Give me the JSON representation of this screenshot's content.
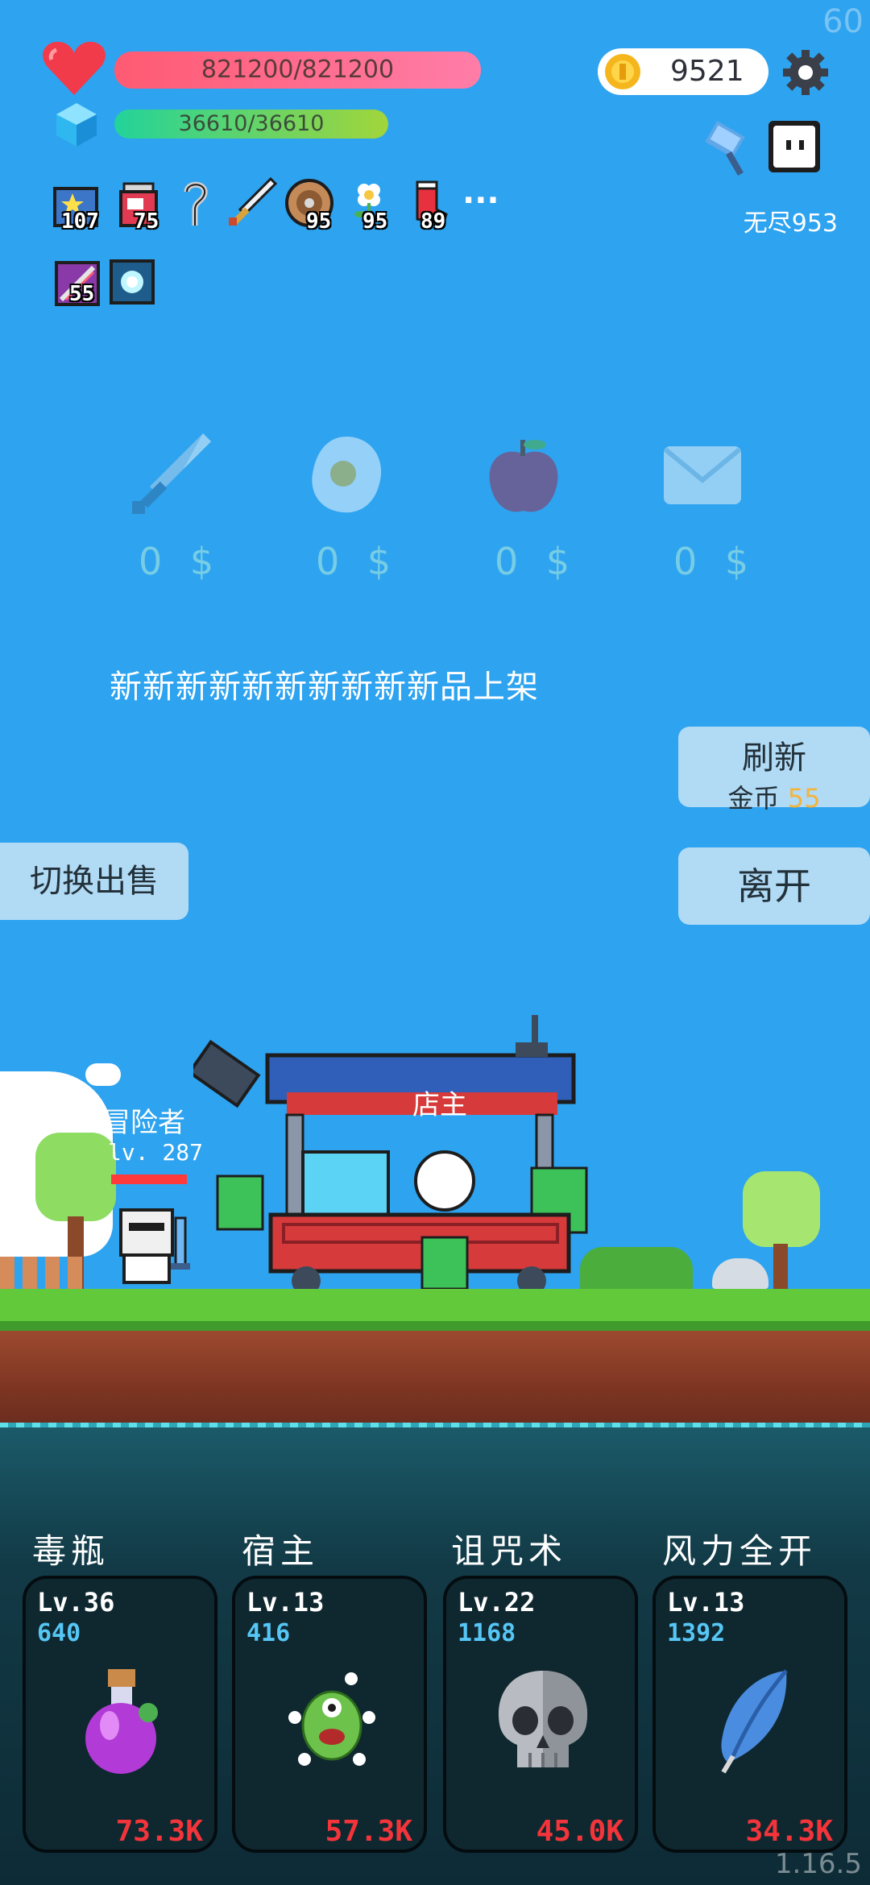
{
  "status": {
    "fps": "60",
    "hp": "821200/821200",
    "mp": "36610/36610",
    "coins": "9521",
    "endless": "无尽953",
    "version": "1.16.5"
  },
  "inventory": {
    "row1": [
      {
        "icon": "star-card-icon",
        "count": "107"
      },
      {
        "icon": "jam-jar-icon",
        "count": "75"
      },
      {
        "icon": "hook-icon",
        "count": ""
      },
      {
        "icon": "sword-icon",
        "count": ""
      },
      {
        "icon": "shield-icon",
        "count": "95"
      },
      {
        "icon": "flower-icon",
        "count": "95"
      },
      {
        "icon": "sock-icon",
        "count": "89"
      }
    ],
    "more": "···",
    "row2": [
      {
        "icon": "crossed-card-icon",
        "count": "55"
      },
      {
        "icon": "light-card-icon",
        "count": ""
      }
    ]
  },
  "shop": {
    "items": [
      {
        "icon": "sword-icon",
        "price": "0 $"
      },
      {
        "icon": "egg-icon",
        "price": "0 $"
      },
      {
        "icon": "apple-icon",
        "price": "0 $"
      },
      {
        "icon": "envelope-icon",
        "price": "0 $"
      }
    ],
    "banner": "新新新新新新新新新新品上架",
    "refresh_label": "刷新",
    "refresh_cost_label": "金币",
    "refresh_cost": "55",
    "leave_label": "离开",
    "switch_label": "切换出售"
  },
  "scene": {
    "player_name": "冒险者",
    "player_level": "lv. 287",
    "shopkeeper": "店主"
  },
  "skills": [
    {
      "title": "毒瓶",
      "level": "Lv.36",
      "value": "640",
      "cost": "73.3K",
      "icon": "poison-bottle-icon"
    },
    {
      "title": "宿主",
      "level": "Lv.13",
      "value": "416",
      "cost": "57.3K",
      "icon": "green-monster-icon"
    },
    {
      "title": "诅咒术",
      "level": "Lv.22",
      "value": "1168",
      "cost": "45.0K",
      "icon": "skull-icon"
    },
    {
      "title": "风力全开",
      "level": "Lv.13",
      "value": "1392",
      "cost": "34.3K",
      "icon": "feather-icon"
    }
  ],
  "colors": {
    "sky": "#2ea3ef",
    "hp": "#ff5a72",
    "mp": "#22d39a",
    "cost": "#f3343a",
    "coin_cost": "#f3b43c"
  }
}
